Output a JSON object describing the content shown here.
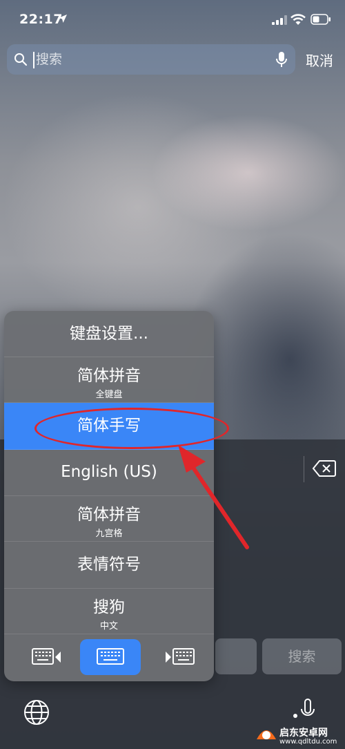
{
  "status": {
    "time": "22:17"
  },
  "search": {
    "placeholder": "搜索",
    "value": "",
    "cancel_label": "取消"
  },
  "menu": {
    "items": [
      {
        "title": "键盘设置...",
        "subtitle": ""
      },
      {
        "title": "简体拼音",
        "subtitle": "全键盘"
      },
      {
        "title": "简体手写",
        "subtitle": "",
        "selected": true
      },
      {
        "title": "English (US)",
        "subtitle": ""
      },
      {
        "title": "简体拼音",
        "subtitle": "九宫格"
      },
      {
        "title": "表情符号",
        "subtitle": ""
      },
      {
        "title": "搜狗",
        "subtitle": "中文"
      }
    ],
    "keyboard_modes": [
      "keyboard-left-icon",
      "keyboard-full-icon",
      "keyboard-right-icon"
    ]
  },
  "keyboard": {
    "search_key_label": "搜索"
  },
  "colors": {
    "accent": "#3a86f7",
    "highlight_ring": "#e0262a"
  },
  "watermark": {
    "label": "启东安卓网",
    "url": "www.qdltdu.com"
  }
}
